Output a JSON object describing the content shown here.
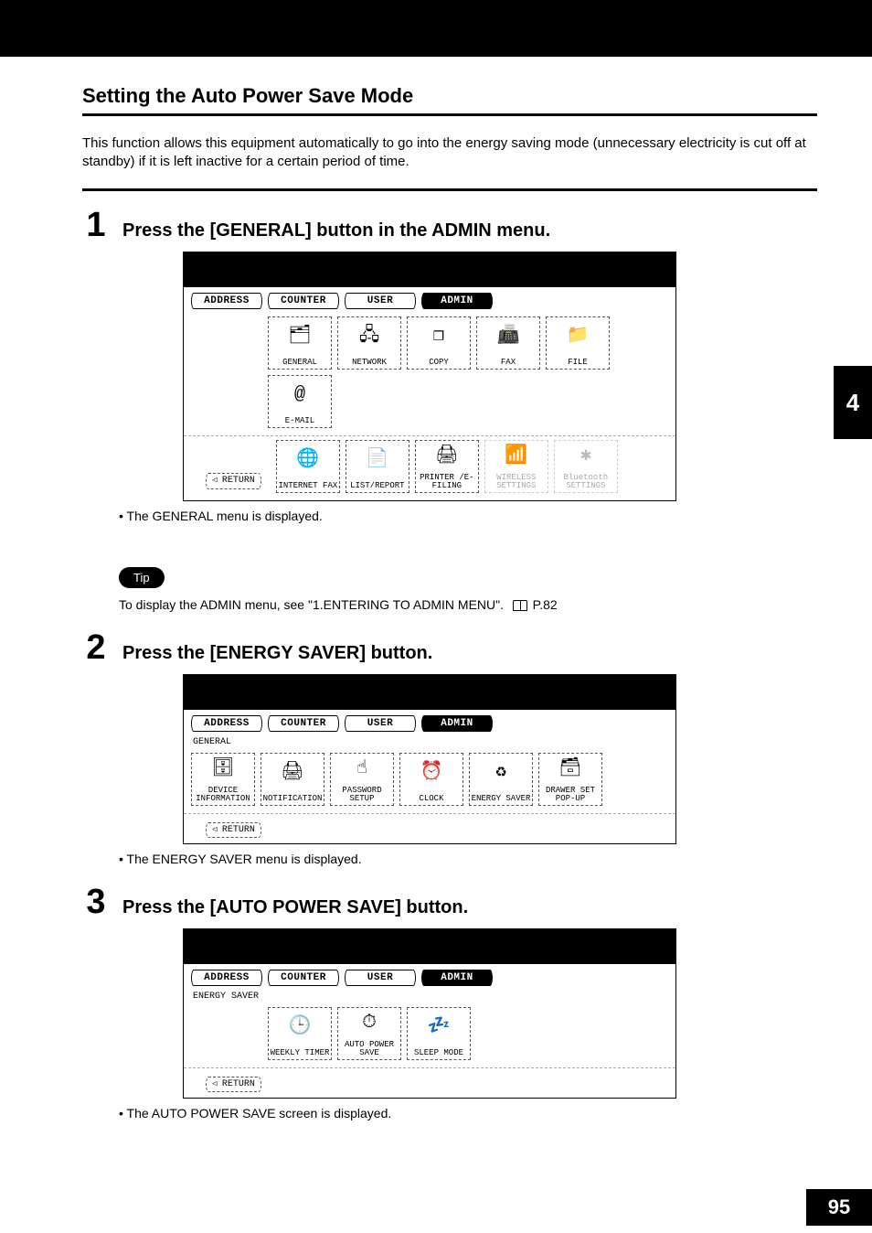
{
  "section_title": "Setting the Auto Power Save Mode",
  "intro": "This function allows this equipment automatically to go into the energy saving mode (unnecessary electricity is cut off at standby) if it is left inactive for a certain period of time.",
  "side_tab": "4",
  "page_number": "95",
  "tip_label": "Tip",
  "tip_text_prefix": "To display the ADMIN menu, see \"1.ENTERING TO ADMIN MENU\".",
  "tip_page_ref": "P.82",
  "tabs": {
    "address": "ADDRESS",
    "counter": "COUNTER",
    "user": "USER",
    "admin": "ADMIN"
  },
  "return_label": "RETURN",
  "steps": [
    {
      "num": "1",
      "title": "Press the [GENERAL] button in the ADMIN menu.",
      "note": "The GENERAL menu is displayed.",
      "row1": [
        {
          "label": "GENERAL",
          "glyph": "🗂"
        },
        {
          "label": "NETWORK",
          "glyph": "🖧"
        },
        {
          "label": "COPY",
          "glyph": "❐"
        },
        {
          "label": "FAX",
          "glyph": "📠"
        },
        {
          "label": "FILE",
          "glyph": "📁"
        },
        {
          "label": "E-MAIL",
          "glyph": "@"
        }
      ],
      "row2": [
        {
          "label": "INTERNET FAX",
          "glyph": "🌐"
        },
        {
          "label": "LIST/REPORT",
          "glyph": "📄"
        },
        {
          "label": "PRINTER /E-FILING",
          "glyph": "🖨"
        },
        {
          "label": "WIRELESS SETTINGS",
          "glyph": "📶",
          "disabled": true
        },
        {
          "label": "Bluetooth SETTINGS",
          "glyph": "✱",
          "disabled": true
        }
      ]
    },
    {
      "num": "2",
      "title": "Press the [ENERGY SAVER] button.",
      "note": "The ENERGY SAVER menu is displayed.",
      "subhead": "GENERAL",
      "row1": [
        {
          "label": "DEVICE INFORMATION",
          "glyph": "🗄"
        },
        {
          "label": "NOTIFICATION",
          "glyph": "🖨"
        },
        {
          "label": "PASSWORD SETUP",
          "glyph": "☝"
        },
        {
          "label": "CLOCK",
          "glyph": "⏰"
        },
        {
          "label": "ENERGY SAVER",
          "glyph": "♻"
        },
        {
          "label": "DRAWER SET POP-UP",
          "glyph": "🗃"
        }
      ]
    },
    {
      "num": "3",
      "title": "Press the [AUTO POWER SAVE] button.",
      "note": "The AUTO POWER SAVE screen is displayed.",
      "subhead": "ENERGY SAVER",
      "row1": [
        {
          "label": "WEEKLY TIMER",
          "glyph": "🕒"
        },
        {
          "label": "AUTO POWER SAVE",
          "glyph": "⏱"
        },
        {
          "label": "SLEEP MODE",
          "glyph": "💤"
        }
      ]
    }
  ]
}
